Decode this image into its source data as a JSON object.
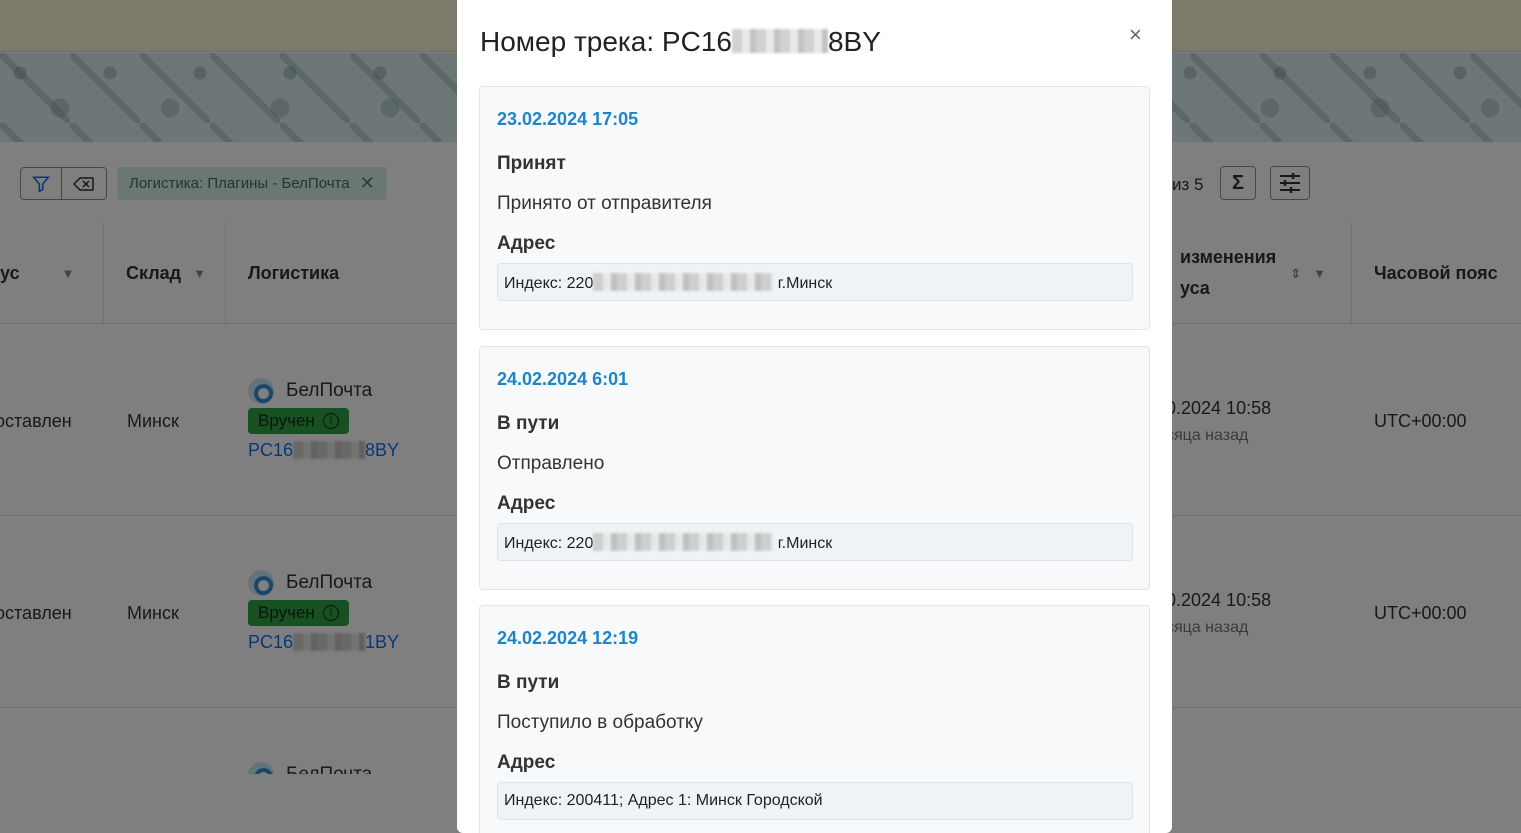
{
  "toolbar": {
    "filter_chip": "Логистика: Плагины - БелПочта",
    "pager_text": "из 5",
    "sum_icon": "sigma-icon",
    "settings_icon": "sliders-icon"
  },
  "table": {
    "headers": {
      "status": "ус",
      "warehouse": "Склад",
      "logistics": "Логистика",
      "changed_line1": "изменения",
      "changed_line2": "уса",
      "timezone": "Часовой пояс"
    },
    "rows": [
      {
        "status": "оставлен",
        "warehouse": "Минск",
        "carrier": "БелПочта",
        "badge": "Вручен",
        "track_prefix": "PC16",
        "track_suffix": "8BY",
        "changed": "0.2024 10:58",
        "changed_sub": "сяца назад",
        "timezone": "UTC+00:00"
      },
      {
        "status": "оставлен",
        "warehouse": "Минск",
        "carrier": "БелПочта",
        "badge": "Вручен",
        "track_prefix": "PC16",
        "track_suffix": "1BY",
        "changed": "0.2024 10:58",
        "changed_sub": "сяца назад",
        "timezone": "UTC+00:00"
      },
      {
        "carrier": "БелПочта"
      }
    ]
  },
  "modal": {
    "title_prefix": "Номер трека: PC16",
    "title_suffix": "8BY",
    "close_label": "×",
    "address_label": "Адрес",
    "events": [
      {
        "date": "23.02.2024 17:05",
        "status": "Принят",
        "description": "Принято от отправителя",
        "address_prefix": "Индекс: 220",
        "address_suffix": "г.Минск"
      },
      {
        "date": "24.02.2024 6:01",
        "status": "В пути",
        "description": "Отправлено",
        "address_prefix": "Индекс: 220",
        "address_suffix": "г.Минск"
      },
      {
        "date": "24.02.2024 12:19",
        "status": "В пути",
        "description": "Поступило в обработку",
        "address_prefix": "Индекс: 200411; Адрес 1: Минск Городской",
        "address_suffix": ""
      }
    ]
  }
}
